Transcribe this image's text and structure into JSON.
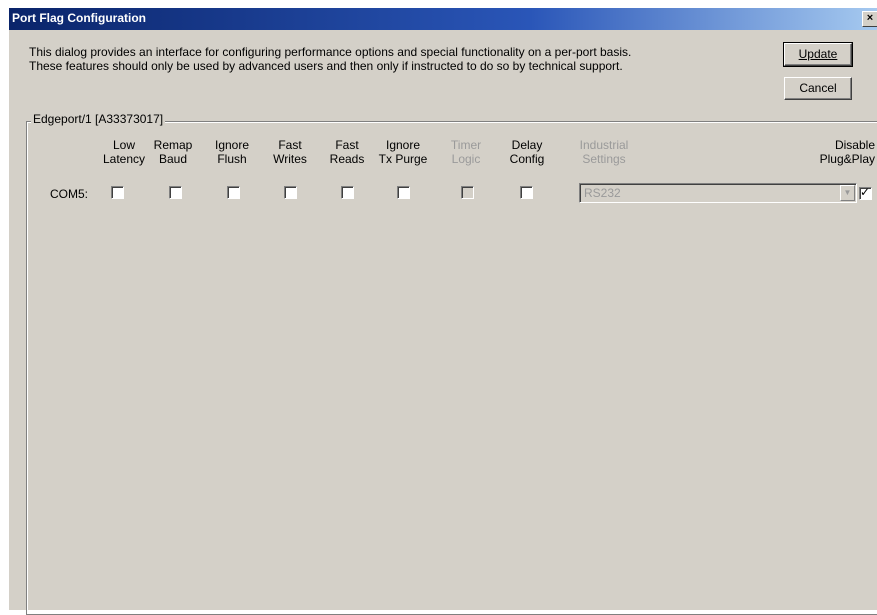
{
  "window": {
    "title": "Port Flag Configuration",
    "close_glyph": "×"
  },
  "description": {
    "line1": "This dialog provides an interface for configuring performance options and special functionality on a per-port basis.",
    "line2": "These features should only be used by advanced users and then only if instructed to do so by technical support."
  },
  "buttons": {
    "update": "Update",
    "cancel": "Cancel"
  },
  "group": {
    "label": "Edgeport/1 [A33373017]"
  },
  "columns": {
    "low_latency": [
      "Low",
      "Latency"
    ],
    "remap_baud": [
      "Remap",
      "Baud"
    ],
    "ignore_flush": [
      "Ignore",
      "Flush"
    ],
    "fast_writes": [
      "Fast",
      "Writes"
    ],
    "fast_reads": [
      "Fast",
      "Reads"
    ],
    "ignore_tx_purge": [
      "Ignore",
      "Tx Purge"
    ],
    "timer_logic": [
      "Timer",
      "Logic"
    ],
    "delay_config": [
      "Delay",
      "Config"
    ],
    "industrial_settings": [
      "Industrial",
      "Settings"
    ],
    "disable_plugplay": [
      "Disable",
      "Plug&Play"
    ]
  },
  "port_row": {
    "label": "COM5:",
    "low_latency": false,
    "remap_baud": false,
    "ignore_flush": false,
    "fast_writes": false,
    "fast_reads": false,
    "ignore_tx_purge": false,
    "timer_logic": false,
    "timer_logic_enabled": false,
    "delay_config": false,
    "industrial_settings_value": "RS232",
    "industrial_settings_enabled": false,
    "disable_plugplay": true
  },
  "colors": {
    "dialog_bg": "#d4d0c8",
    "titlebar_start": "#0a246a",
    "disabled_text": "#9a9a9a"
  }
}
